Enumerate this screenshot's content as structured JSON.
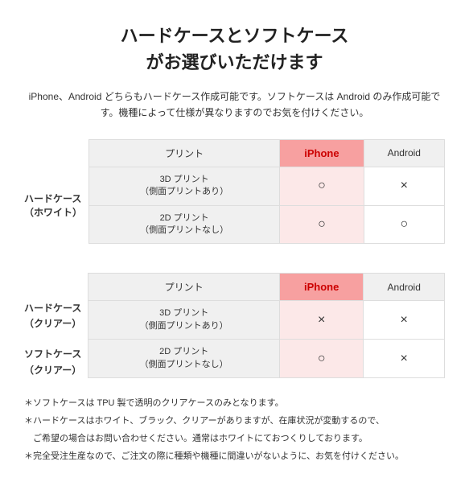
{
  "title": {
    "line1": "ハードケースとソフトケース",
    "line2": "がお選びいただけます"
  },
  "subtitle": "iPhone、Android どちらもハードケース作成可能です。ソフトケースは\nAndroid のみ作成可能です。機種によって仕様が異なりますのでお気を付けください。",
  "table1": {
    "row_header": "ハードケース\n（ホワイト）",
    "col_print": "プリント",
    "col_iphone": "iPhone",
    "col_android": "Android",
    "rows": [
      {
        "label_line1": "3D プリント",
        "label_line2": "（側面プリントあり）",
        "iphone": "○",
        "android": "×"
      },
      {
        "label_line1": "2D プリント",
        "label_line2": "（側面プリントなし）",
        "iphone": "○",
        "android": "○"
      }
    ]
  },
  "table2": {
    "row_header1": "ハードケース\n（クリアー）",
    "row_header2": "ソフトケース\n（クリアー）",
    "col_print": "プリント",
    "col_iphone": "iPhone",
    "col_android": "Android",
    "rows": [
      {
        "label_line1": "3D プリント",
        "label_line2": "（側面プリントあり）",
        "iphone": "×",
        "android": "×"
      },
      {
        "label_line1": "2D プリント",
        "label_line2": "（側面プリントなし）",
        "iphone": "○",
        "android": "×"
      }
    ]
  },
  "notes": [
    "＊ソフトケースは TPU 製で透明のクリアケースのみとなります。",
    "＊ハードケースはホワイト、ブラック、クリアーがありますが、在庫状況が変動するので、",
    "　ご希望の場合はお問い合わせください。通常はホワイトにておつくりしております。",
    "＊完全受注生産なので、ご注文の際に種類や機種に間違いがないように、お気を付けください。"
  ]
}
